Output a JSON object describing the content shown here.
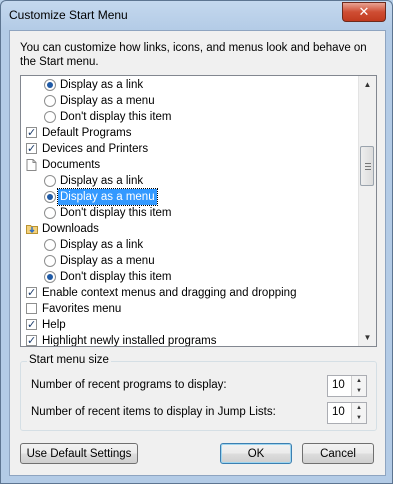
{
  "window": {
    "title": "Customize Start Menu",
    "close_label": "✕"
  },
  "description": "You can customize how links, icons, and menus look and behave on the Start menu.",
  "options_list": [
    {
      "kind": "radio",
      "label": "Display as a link",
      "checked": true,
      "indent": 1
    },
    {
      "kind": "radio",
      "label": "Display as a menu",
      "checked": false,
      "indent": 1
    },
    {
      "kind": "radio",
      "label": "Don't display this item",
      "checked": false,
      "indent": 1
    },
    {
      "kind": "checkbox",
      "label": "Default Programs",
      "checked": true,
      "indent": 0
    },
    {
      "kind": "checkbox",
      "label": "Devices and Printers",
      "checked": true,
      "indent": 0
    },
    {
      "kind": "header",
      "label": "Documents",
      "icon": "document-icon",
      "indent": 0
    },
    {
      "kind": "radio",
      "label": "Display as a link",
      "checked": false,
      "indent": 1
    },
    {
      "kind": "radio",
      "label": "Display as a menu",
      "checked": true,
      "indent": 1,
      "selected": true
    },
    {
      "kind": "radio",
      "label": "Don't display this item",
      "checked": false,
      "indent": 1
    },
    {
      "kind": "header",
      "label": "Downloads",
      "icon": "folder-download-icon",
      "indent": 0
    },
    {
      "kind": "radio",
      "label": "Display as a link",
      "checked": false,
      "indent": 1
    },
    {
      "kind": "radio",
      "label": "Display as a menu",
      "checked": false,
      "indent": 1
    },
    {
      "kind": "radio",
      "label": "Don't display this item",
      "checked": true,
      "indent": 1
    },
    {
      "kind": "checkbox",
      "label": "Enable context menus and dragging and dropping",
      "checked": true,
      "indent": 0
    },
    {
      "kind": "checkbox",
      "label": "Favorites menu",
      "checked": false,
      "indent": 0
    },
    {
      "kind": "checkbox",
      "label": "Help",
      "checked": true,
      "indent": 0
    },
    {
      "kind": "checkbox",
      "label": "Highlight newly installed programs",
      "checked": true,
      "indent": 0
    }
  ],
  "start_menu_size": {
    "title": "Start menu size",
    "recent_programs_label": "Number of recent programs to display:",
    "recent_programs_value": "10",
    "recent_items_label": "Number of recent items to display in Jump Lists:",
    "recent_items_value": "10"
  },
  "buttons": {
    "defaults": "Use Default Settings",
    "ok": "OK",
    "cancel": "Cancel"
  }
}
